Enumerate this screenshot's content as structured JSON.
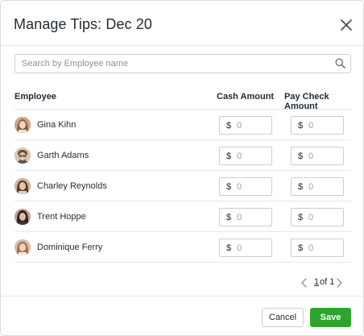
{
  "modal": {
    "title": "Manage Tips: Dec 20",
    "close_icon": "close-icon"
  },
  "search": {
    "placeholder": "Search by Employee name",
    "value": "",
    "icon": "search-icon"
  },
  "table": {
    "columns": [
      "Employee",
      "Cash Amount",
      "Pay Check Amount"
    ],
    "currency_symbol": "$",
    "amount_placeholder": "0",
    "rows": [
      {
        "name": "Gina Kihn",
        "cash": "",
        "paycheck": ""
      },
      {
        "name": "Garth Adams",
        "cash": "",
        "paycheck": ""
      },
      {
        "name": "Charley Reynolds",
        "cash": "",
        "paycheck": ""
      },
      {
        "name": "Trent Hoppe",
        "cash": "",
        "paycheck": ""
      },
      {
        "name": "Dominique Ferry",
        "cash": "",
        "paycheck": ""
      }
    ]
  },
  "pagination": {
    "current": "1",
    "of_label": " of 1",
    "prev_icon": "chevron-left-icon",
    "next_icon": "chevron-right-icon"
  },
  "footer": {
    "cancel_label": "Cancel",
    "save_label": "Save"
  },
  "colors": {
    "save_button": "#2ca52c",
    "border": "#c9cfd6",
    "divider": "#e4e8ed"
  }
}
